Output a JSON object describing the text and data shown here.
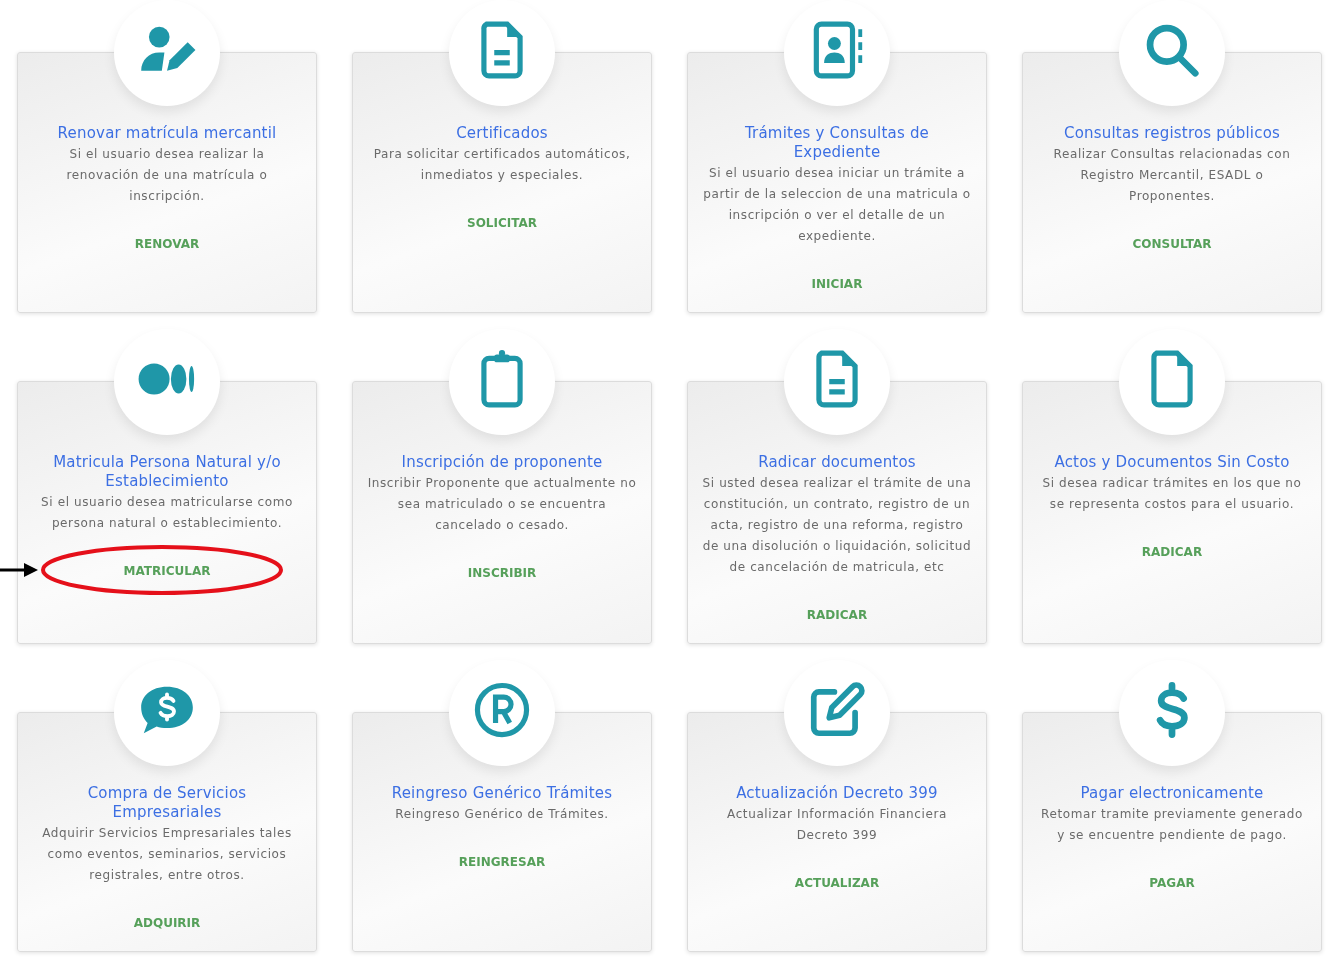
{
  "cards": [
    {
      "title": "Renovar matrícula mercantil",
      "description": "Si el usuario desea realizar la renovación de una matrícula o inscripción.",
      "action": "RENOVAR",
      "highlighted": false
    },
    {
      "title": "Certificados",
      "description": "Para solicitar certificados automáticos, inmediatos y especiales.",
      "action": "SOLICITAR",
      "highlighted": false
    },
    {
      "title": "Trámites y Consultas de Expediente",
      "description": "Si el usuario desea iniciar un trámite a partir de la seleccion de una matricula o inscripción o ver el detalle de un expediente.",
      "action": "INICIAR",
      "highlighted": false
    },
    {
      "title": "Consultas registros públicos",
      "description": "Realizar Consultas relacionadas con Registro Mercantil, ESADL o Proponentes.",
      "action": "CONSULTAR",
      "highlighted": false
    },
    {
      "title": "Matricula Persona Natural y/o Establecimiento",
      "description": "Si el usuario desea matricularse como persona natural o establecimiento.",
      "action": "MATRICULAR",
      "highlighted": true
    },
    {
      "title": "Inscripción de proponente",
      "description": "Inscribir Proponente que actualmente no sea matriculado o se encuentra cancelado o cesado.",
      "action": "INSCRIBIR",
      "highlighted": false
    },
    {
      "title": "Radicar documentos",
      "description": "Si usted desea realizar el trámite de una constitución, un contrato, registro de un acta, registro de una reforma, registro de una disolución o liquidación, solicitud de cancelación de matricula, etc",
      "action": "RADICAR",
      "highlighted": false
    },
    {
      "title": "Actos y Documentos Sin Costo",
      "description": "Si desea radicar trámites en los que no se representa costos para el usuario.",
      "action": "RADICAR",
      "highlighted": false
    },
    {
      "title": "Compra de Servicios Empresariales",
      "description": "Adquirir Servicios Empresariales tales como eventos, seminarios, servicios registrales, entre otros.",
      "action": "ADQUIRIR",
      "highlighted": false
    },
    {
      "title": "Reingreso Genérico Trámites",
      "description": "Reingreso Genérico de Trámites.",
      "action": "REINGRESAR",
      "highlighted": false
    },
    {
      "title": "Actualización Decreto 399",
      "description": "Actualizar Información Financiera Decreto 399",
      "action": "ACTUALIZAR",
      "highlighted": false
    },
    {
      "title": "Pagar electronicamente",
      "description": "Retomar tramite previamente generado y se encuentre pendiente de pago.",
      "action": "PAGAR",
      "highlighted": false
    }
  ]
}
